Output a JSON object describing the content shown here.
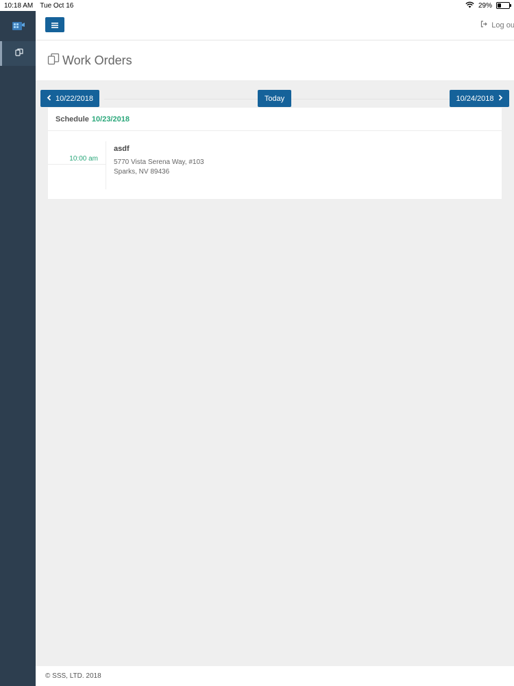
{
  "status_bar": {
    "time": "10:18 AM",
    "date": "Tue Oct 16",
    "battery": "29%",
    "battery_level": 0.29,
    "icons": [
      "wifi-icon",
      "battery-icon"
    ]
  },
  "header": {
    "menu_icon": "hamburger-icon",
    "logout_label": "Log out",
    "logout_icon": "sign-out-icon"
  },
  "sidebar": {
    "items": [
      {
        "icon": "work-orders-icon",
        "active": true
      }
    ]
  },
  "page": {
    "title": "Work Orders",
    "title_icon": "copy-icon"
  },
  "nav": {
    "prev_label": "10/22/2018",
    "today_label": "Today",
    "next_label": "10/24/2018"
  },
  "schedule": {
    "label": "Schedule",
    "date": "10/23/2018",
    "entries": [
      {
        "time": "10:00 am",
        "name": "asdf",
        "address_line1": "5770 Vista Serena Way, #103",
        "address_line2": "Sparks, NV 89436"
      }
    ]
  },
  "footer": {
    "copyright": "© SSS, LTD. 2018"
  },
  "colors": {
    "primary": "#15629a",
    "accent_green": "#2aa77a",
    "sidebar": "#2d3e4f",
    "background": "#efefef"
  }
}
